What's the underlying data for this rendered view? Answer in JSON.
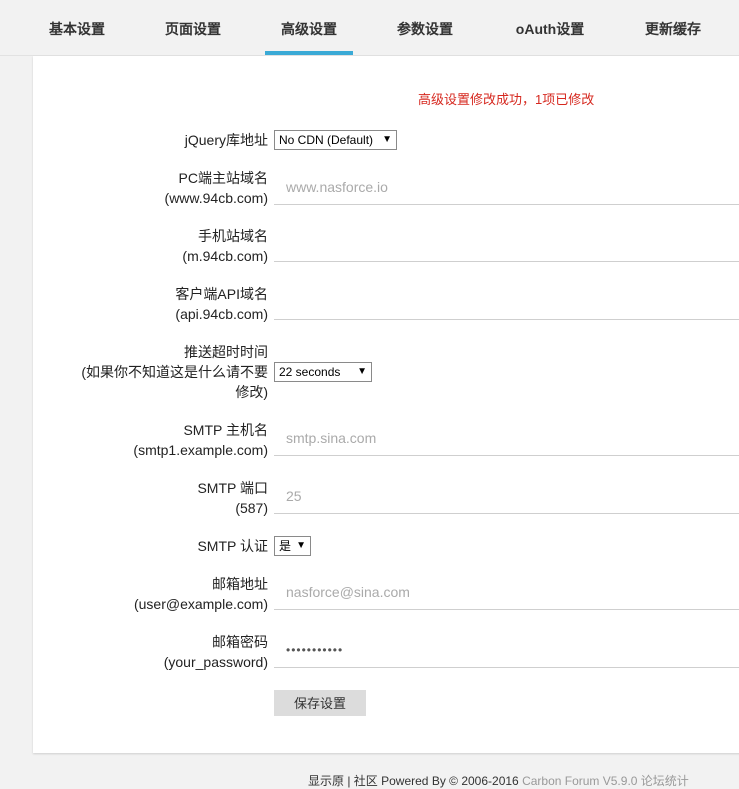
{
  "tabs": [
    {
      "label": "基本设置",
      "active": false
    },
    {
      "label": "页面设置",
      "active": false
    },
    {
      "label": "高级设置",
      "active": true
    },
    {
      "label": "参数设置",
      "active": false
    },
    {
      "label": "oAuth设置",
      "active": false
    },
    {
      "label": "更新缓存",
      "active": false
    }
  ],
  "success_message": "高级设置修改成功，1项已修改",
  "form": {
    "jquery_label": "jQuery库地址",
    "jquery_value": "No CDN (Default)",
    "pc_label_1": "PC端主站域名",
    "pc_label_2": "(www.94cb.com)",
    "pc_placeholder": "www.nasforce.io",
    "mobile_label_1": "手机站域名",
    "mobile_label_2": "(m.94cb.com)",
    "mobile_value": "",
    "api_label_1": "客户端API域名",
    "api_label_2": "(api.94cb.com)",
    "api_value": "",
    "push_label_1": "推送超时时间",
    "push_label_2": "(如果你不知道这是什么请不要",
    "push_label_3": "修改)",
    "push_value": "22 seconds",
    "smtp_host_label_1": "SMTP 主机名",
    "smtp_host_label_2": "(smtp1.example.com)",
    "smtp_host_placeholder": "smtp.sina.com",
    "smtp_port_label_1": "SMTP 端口",
    "smtp_port_label_2": "(587)",
    "smtp_port_placeholder": "25",
    "smtp_auth_label": "SMTP 认证",
    "smtp_auth_value": "是",
    "email_label_1": "邮箱地址",
    "email_label_2": "(user@example.com)",
    "email_placeholder": "nasforce@sina.com",
    "password_label_1": "邮箱密码",
    "password_label_2": "(your_password)",
    "password_mask": "•••••••••••"
  },
  "save_button": "保存设置",
  "footer": {
    "text": "显示原 | 社区 Powered By © 2006-2016",
    "text2": "Carbon Forum V5.9.0 论坛统计"
  }
}
